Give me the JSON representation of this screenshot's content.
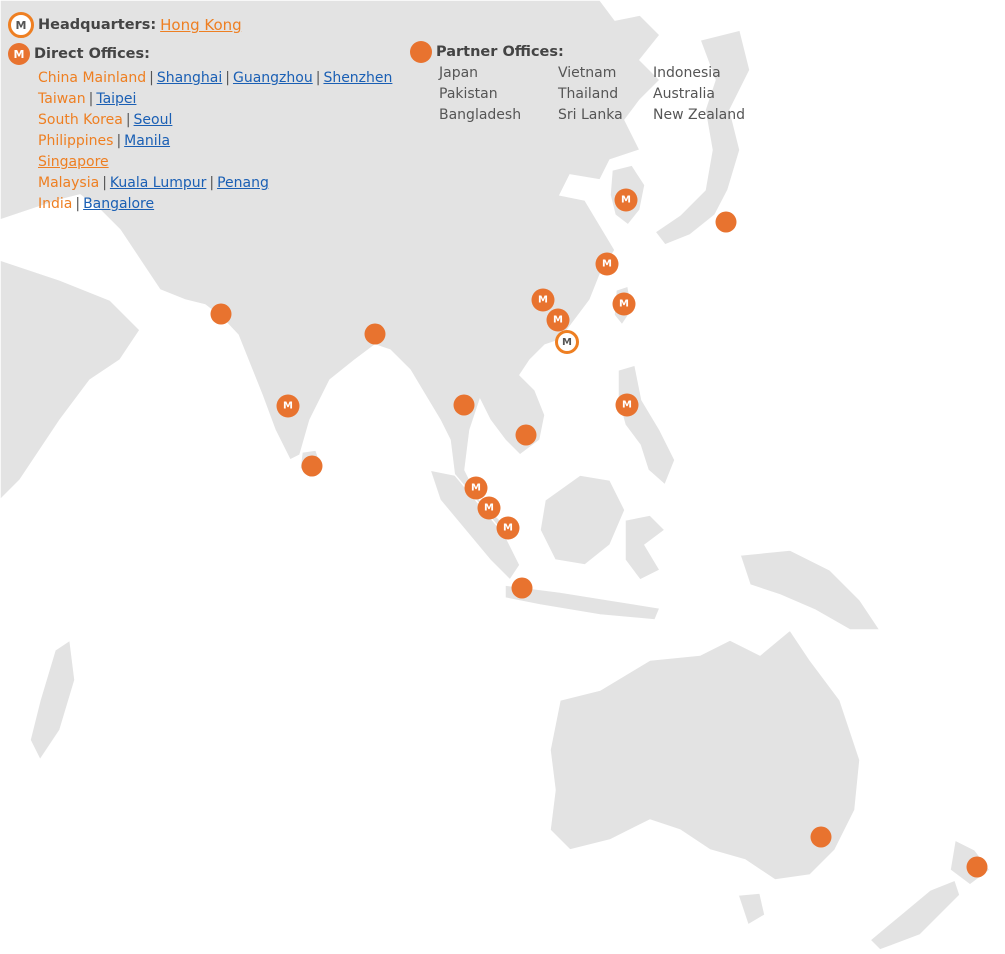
{
  "legend": {
    "hq_title": "Headquarters:",
    "hq_city": "Hong Kong",
    "direct_title": "Direct Offices:",
    "partner_title": "Partner Offices:",
    "icon_glyph": "M",
    "direct": [
      {
        "country": "China Mainland",
        "cities": [
          "Shanghai",
          "Guangzhou",
          "Shenzhen"
        ]
      },
      {
        "country": "Taiwan",
        "cities": [
          "Taipei"
        ]
      },
      {
        "country": "South Korea",
        "cities": [
          "Seoul"
        ]
      },
      {
        "country": "Philippines",
        "cities": [
          "Manila"
        ]
      },
      {
        "country": "Singapore",
        "cities": [],
        "country_is_link": true
      },
      {
        "country": "Malaysia",
        "cities": [
          "Kuala Lumpur",
          "Penang"
        ]
      },
      {
        "country": "India",
        "cities": [
          "Bangalore"
        ]
      }
    ],
    "partners": [
      "Japan",
      "Vietnam",
      "Indonesia",
      "Pakistan",
      "Thailand",
      "Australia",
      "Bangladesh",
      "Sri Lanka",
      "New Zealand"
    ]
  },
  "colors": {
    "accent": "#e8732f",
    "link": "#1a5fb4",
    "land": "#e3e3e3"
  }
}
